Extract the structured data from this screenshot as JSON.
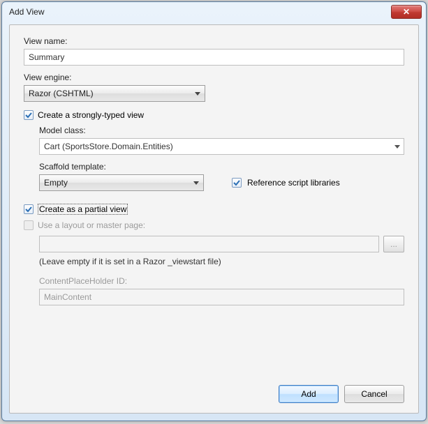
{
  "window": {
    "title": "Add View",
    "close_icon": "✕"
  },
  "labels": {
    "view_name": "View name:",
    "view_engine": "View engine:",
    "create_strongly_typed": "Create a strongly-typed view",
    "model_class": "Model class:",
    "scaffold_template": "Scaffold template:",
    "reference_script_libs": "Reference script libraries",
    "create_partial": "Create as a partial view",
    "use_layout": "Use a layout or master page:",
    "hint": "(Leave empty if it is set in a Razor _viewstart file)",
    "content_placeholder": "ContentPlaceHolder ID:",
    "browse": "..."
  },
  "values": {
    "view_name": "Summary",
    "view_engine": "Razor (CSHTML)",
    "model_class": "Cart (SportsStore.Domain.Entities)",
    "scaffold_template": "Empty",
    "layout_path": "",
    "placeholder_id": "MainContent"
  },
  "checks": {
    "strongly_typed": true,
    "reference_scripts": true,
    "partial_view": true,
    "use_layout": false
  },
  "buttons": {
    "add": "Add",
    "cancel": "Cancel"
  }
}
